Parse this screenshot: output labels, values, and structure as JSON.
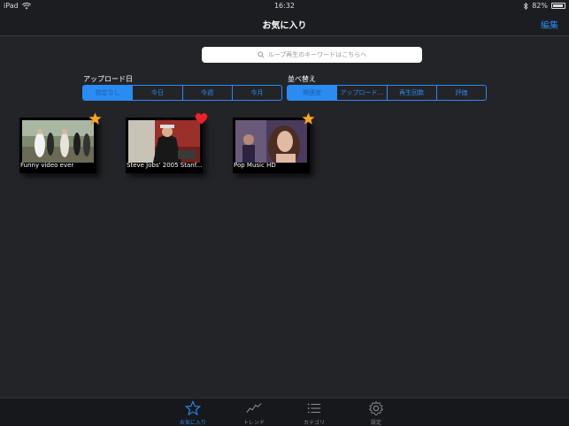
{
  "colors": {
    "accent": "#2a8bf2",
    "background": "#232428",
    "star": "#f5a623",
    "heart": "#e8232a"
  },
  "status_bar": {
    "device": "iPad",
    "time": "16:32",
    "battery": "82%"
  },
  "nav": {
    "title": "お気に入り",
    "edit_label": "編集"
  },
  "search": {
    "placeholder": "ループ再生のキーワードはこちらへ",
    "icon": "search-icon"
  },
  "upload_filter": {
    "label": "アップロード日",
    "options": [
      "指定なし",
      "今日",
      "今週",
      "今月"
    ],
    "selected": 0
  },
  "sort": {
    "label": "並べ替え",
    "options": [
      "関連度",
      "アップロード...",
      "再生回数",
      "評価"
    ],
    "selected": 0
  },
  "favorites": [
    {
      "title": "Funny video ever",
      "badge": "star-icon"
    },
    {
      "title": "Steve Jobs' 2005 Stanf...",
      "badge": "heart-icon"
    },
    {
      "title": "Pop Music HD",
      "badge": "star-icon"
    }
  ],
  "tabs": [
    {
      "label": "お気に入り",
      "icon": "star-icon",
      "active": true
    },
    {
      "label": "トレンド",
      "icon": "trend-icon",
      "active": false
    },
    {
      "label": "カテゴリ",
      "icon": "list-icon",
      "active": false
    },
    {
      "label": "設定",
      "icon": "gear-icon",
      "active": false
    }
  ]
}
